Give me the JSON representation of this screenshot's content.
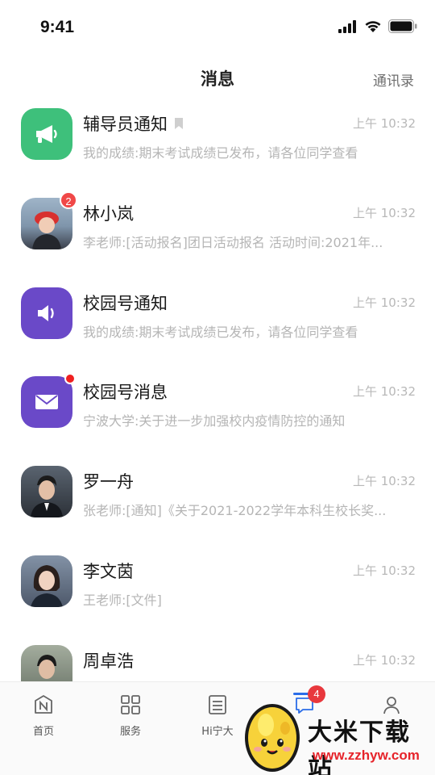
{
  "status_bar": {
    "time": "9:41"
  },
  "header": {
    "title": "消息",
    "contacts_label": "通讯录"
  },
  "chats": [
    {
      "name": "辅导员通知",
      "time": "上午 10:32",
      "preview": "我的成绩:期末考试成绩已发布，请各位同学查看",
      "avatar": "megaphone-icon",
      "avatar_color": "#3ec07b",
      "badge": "",
      "pinned": true
    },
    {
      "name": "林小岚",
      "time": "上午 10:32",
      "preview": "李老师:[活动报名]团日活动报名 活动时间:2021年...",
      "avatar": "photo",
      "avatar_color": "#8fa3b8",
      "badge": "2",
      "pinned": false
    },
    {
      "name": "校园号通知",
      "time": "上午 10:32",
      "preview": "我的成绩:期末考试成绩已发布，请各位同学查看",
      "avatar": "speaker-icon",
      "avatar_color": "#6a49c8",
      "badge": "",
      "pinned": false
    },
    {
      "name": "校园号消息",
      "time": "上午 10:32",
      "preview": "宁波大学:关于进一步加强校内疫情防控的通知",
      "avatar": "mail-icon",
      "avatar_color": "#6a49c8",
      "badge": "dot",
      "pinned": false
    },
    {
      "name": "罗一舟",
      "time": "上午 10:32",
      "preview": "张老师:[通知]《关于2021-2022学年本科生校长奖...",
      "avatar": "photo",
      "avatar_color": "#3f4750",
      "badge": "",
      "pinned": false
    },
    {
      "name": "李文茵",
      "time": "上午 10:32",
      "preview": "王老师:[文件]",
      "avatar": "photo",
      "avatar_color": "#6d7a8e",
      "badge": "",
      "pinned": false
    },
    {
      "name": "周卓浩",
      "time": "上午 10:32",
      "preview": "",
      "avatar": "photo",
      "avatar_color": "#7a8a7a",
      "badge": "",
      "pinned": false
    }
  ],
  "tabs": [
    {
      "label": "首页",
      "icon": "home-icon"
    },
    {
      "label": "服务",
      "icon": "grid-icon"
    },
    {
      "label": "Hi宁大",
      "icon": "list-icon"
    },
    {
      "label": "",
      "icon": "message-icon",
      "badge": "4"
    },
    {
      "label": "",
      "icon": "profile-icon"
    }
  ],
  "watermark": {
    "text": "大米下载站",
    "url": "www.zzhyw.com"
  },
  "colors": {
    "accent": "#2b6de8",
    "badge": "#f04848",
    "green": "#3ec07b",
    "purple": "#6a49c8"
  }
}
